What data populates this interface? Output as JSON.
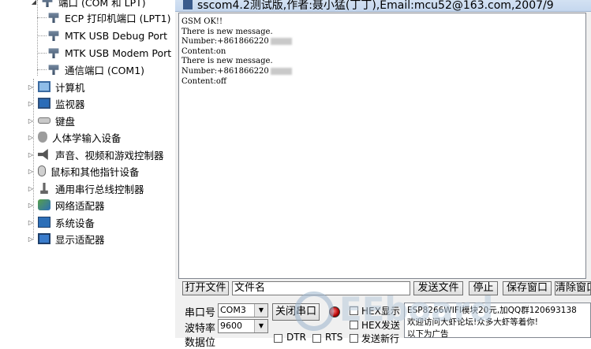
{
  "device_tree": {
    "ports_group": "端口 (COM 和 LPT)",
    "ports": [
      "ECP 打印机端口 (LPT1)",
      "MTK USB Debug Port",
      "MTK USB Modem Port",
      "通信端口 (COM1)"
    ],
    "categories": [
      "计算机",
      "监视器",
      "键盘",
      "人体学输入设备",
      "声音、视频和游戏控制器",
      "鼠标和其他指针设备",
      "通用串行总线控制器",
      "网络适配器",
      "系统设备",
      "显示适配器"
    ]
  },
  "sscom": {
    "title": "sscom4.2测试版,作者:聂小猛(丁丁),Email:mcu52@163.com,2007/9",
    "output_lines": [
      {
        "text": "GSM OK!!",
        "blur": false
      },
      {
        "text": "There is new message.",
        "blur": false
      },
      {
        "text": "Number:+861866220",
        "blur": true
      },
      {
        "text": "Content:on",
        "blur": false
      },
      {
        "text": "There is new message.",
        "blur": false
      },
      {
        "text": "Number:+861866220",
        "blur": true
      },
      {
        "text": "Content:off",
        "blur": false
      }
    ],
    "open_file_btn": "打开文件",
    "filename_field": "文件名",
    "send_file_btn": "发送文件",
    "stop_btn": "停止",
    "save_window_btn": "保存窗口",
    "clear_window_btn": "清除窗口",
    "port_label": "串口号",
    "port_value": "COM3",
    "baud_label": "波特率",
    "baud_value": "9600",
    "databits_label": "数据位",
    "close_port_btn": "关闭串口",
    "hex_display": "HEX显示",
    "hex_send": "HEX发送",
    "send_newline": "发送新行",
    "dtr": "DTR",
    "rts": "RTS",
    "send_box_lines": [
      "ESP8266WIFI模块20元,加QQ群120693138",
      "欢迎访问大虾论坛!众多大虾等着你!",
      "以下为广告"
    ]
  },
  "watermark": "EEboard",
  "colors": {
    "titlebar": "#c5d7ee",
    "led": "#b30000",
    "tree_icon_blue": "#2d6fb8"
  }
}
